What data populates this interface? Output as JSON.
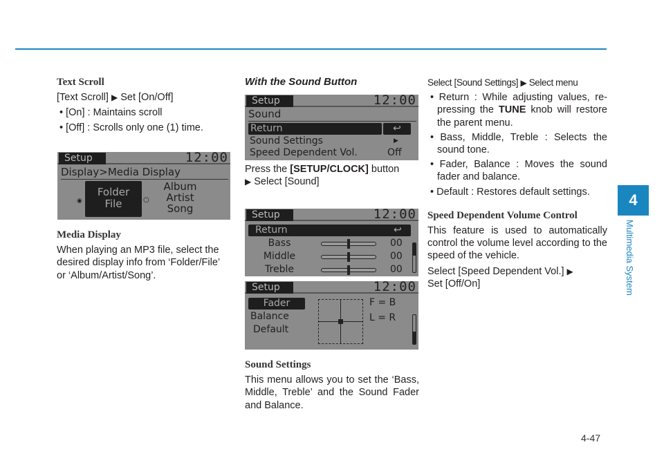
{
  "colors": {
    "accent": "#1a86c0",
    "screen_bg": "#8b8b8b",
    "screen_highlight": "#1e1e1e"
  },
  "col1": {
    "text_scroll_heading": "Text Scroll",
    "text_scroll_path_a": "[Text Scroll]",
    "text_scroll_path_b": "Set [On/Off]",
    "bullets": [
      "• [On] : Maintains scroll",
      "• [Off] : Scrolls only one (1) time."
    ],
    "media_heading": "Media Display",
    "media_para": "When playing an MP3 file, select the desired display info from ‘Folder/File’ or ‘Album/Artist/Song’."
  },
  "screen1": {
    "tag": "Setup",
    "clock": "12:00",
    "title": "Display>Media Display",
    "opt1_a": "Folder",
    "opt1_b": "File",
    "opt2_a": "Album",
    "opt2_b": "Artist",
    "opt2_c": "Song"
  },
  "col2": {
    "heading": "With the Sound Button",
    "press_a": "Press the",
    "press_btn": "[SETUP/CLOCK]",
    "press_b": "button",
    "press_c": "Select [Sound]",
    "sound_heading": "Sound Settings",
    "sound_para": "This menu allows you to set the ‘Bass, Middle, Treble’ and the Sound Fader and Balance."
  },
  "screen2": {
    "tag": "Setup",
    "clock": "12:00",
    "title": "Sound",
    "items": [
      "Return",
      "Sound Settings",
      "Speed Dependent Vol."
    ],
    "svol_value": "Off"
  },
  "screen3": {
    "tag": "Setup",
    "clock": "12:00",
    "return": "Return",
    "bands": [
      {
        "label": "Bass",
        "value": "00"
      },
      {
        "label": "Middle",
        "value": "00"
      },
      {
        "label": "Treble",
        "value": "00"
      }
    ]
  },
  "screen4": {
    "tag": "Setup",
    "clock": "12:00",
    "items": [
      "Fader",
      "Balance",
      "Default"
    ],
    "fb": "F = B",
    "lr": "L = R"
  },
  "col3": {
    "heading_a": "Select [Sound Settings]",
    "heading_b": "Select menu",
    "bullets": [
      {
        "pre": "• Return : While adjusting values, re-pressing the ",
        "bold": "TUNE",
        "post": " knob will restore the parent menu."
      },
      {
        "pre": "• Bass, Middle, Treble : Selects the sound tone.",
        "bold": "",
        "post": ""
      },
      {
        "pre": "• Fader, Balance : Moves the sound fader and balance.",
        "bold": "",
        "post": ""
      },
      {
        "pre": "• Default : Restores default settings.",
        "bold": "",
        "post": ""
      }
    ],
    "svc_heading": "Speed Dependent Volume Control",
    "svc_para": "This feature is used to automatically control the volume level according to the speed of the vehicle.",
    "svc_select_a": "Select [Speed Dependent Vol.]",
    "svc_select_b": "Set [Off/On]"
  },
  "side": {
    "chapter": "4",
    "section": "Multimedia System"
  },
  "page_number": "4-47"
}
